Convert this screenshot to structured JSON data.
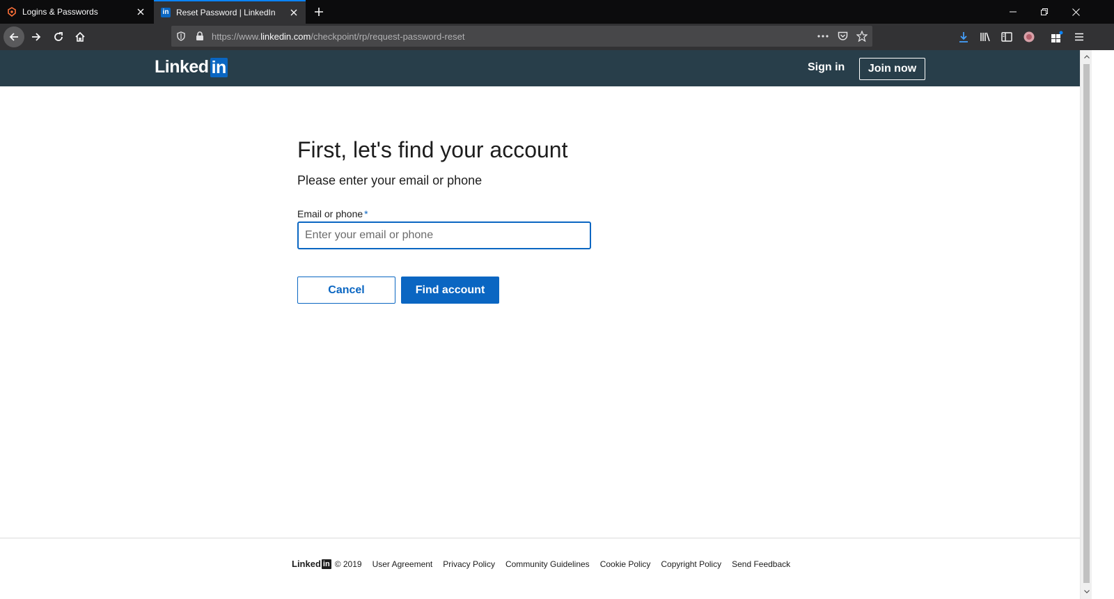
{
  "browser": {
    "tabs": [
      {
        "title": "Logins & Passwords",
        "icon": "lockwise-icon",
        "active": false
      },
      {
        "title": "Reset Password | LinkedIn",
        "icon": "linkedin-favicon",
        "active": true
      }
    ],
    "url": {
      "prefix": "https://www.",
      "domain": "linkedin.com",
      "path": "/checkpoint/rp/request-password-reset"
    },
    "favicon_text": "in"
  },
  "header": {
    "logo_text": "Linked",
    "logo_box": "in",
    "sign_in": "Sign in",
    "join_now": "Join now"
  },
  "form": {
    "title": "First, let's find your account",
    "subtitle": "Please enter your email or phone",
    "label": "Email or phone",
    "required_mark": "*",
    "placeholder": "Enter your email or phone",
    "value": "",
    "cancel": "Cancel",
    "submit": "Find account"
  },
  "footer": {
    "logo_text": "Linked",
    "logo_box": "in",
    "copyright": "© 2019",
    "links": [
      "User Agreement",
      "Privacy Policy",
      "Community Guidelines",
      "Cookie Policy",
      "Copyright Policy",
      "Send Feedback"
    ]
  },
  "colors": {
    "brand_blue": "#0a66c2",
    "header_bg": "#283e4a",
    "chrome_dark": "#0c0c0d",
    "chrome_toolbar": "#323234"
  }
}
